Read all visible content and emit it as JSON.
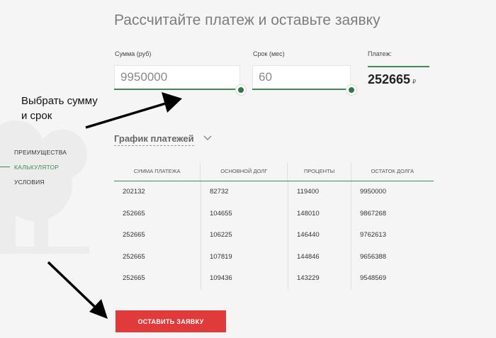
{
  "page_title": "Рассчитайте платеж и оставьте заявку",
  "side_nav": {
    "items": [
      {
        "label": "ПРЕИМУЩЕСТВА",
        "active": false
      },
      {
        "label": "КАЛЬКУЛЯТОР",
        "active": true
      },
      {
        "label": "УСЛОВИЯ",
        "active": false
      }
    ]
  },
  "calculator": {
    "amount": {
      "label": "Сумма (руб)",
      "value": "9950000"
    },
    "term": {
      "label": "Срок (мес)",
      "value": "60"
    },
    "payment": {
      "label": "Платеж:",
      "value": "252665",
      "unit": "₽"
    }
  },
  "annotation": {
    "line1": "Выбрать сумму",
    "line2": "и срок"
  },
  "schedule": {
    "toggle_label": "График платежей",
    "columns": [
      "СУММА ПЛАТЕЖА",
      "ОСНОВНОЙ ДОЛГ",
      "ПРОЦЕНТЫ",
      "ОСТАТОК ДОЛГА"
    ],
    "rows": [
      [
        "202132",
        "82732",
        "119400",
        "9950000"
      ],
      [
        "252665",
        "104655",
        "148010",
        "9867268"
      ],
      [
        "252665",
        "106225",
        "146440",
        "9762613"
      ],
      [
        "252665",
        "107819",
        "144846",
        "9656388"
      ],
      [
        "252665",
        "109436",
        "143229",
        "9548569"
      ]
    ]
  },
  "submit_label": "ОСТАВИТЬ ЗАЯВКУ",
  "colors": {
    "accent_green": "#3e8a55",
    "button_red": "#e03a3a"
  }
}
